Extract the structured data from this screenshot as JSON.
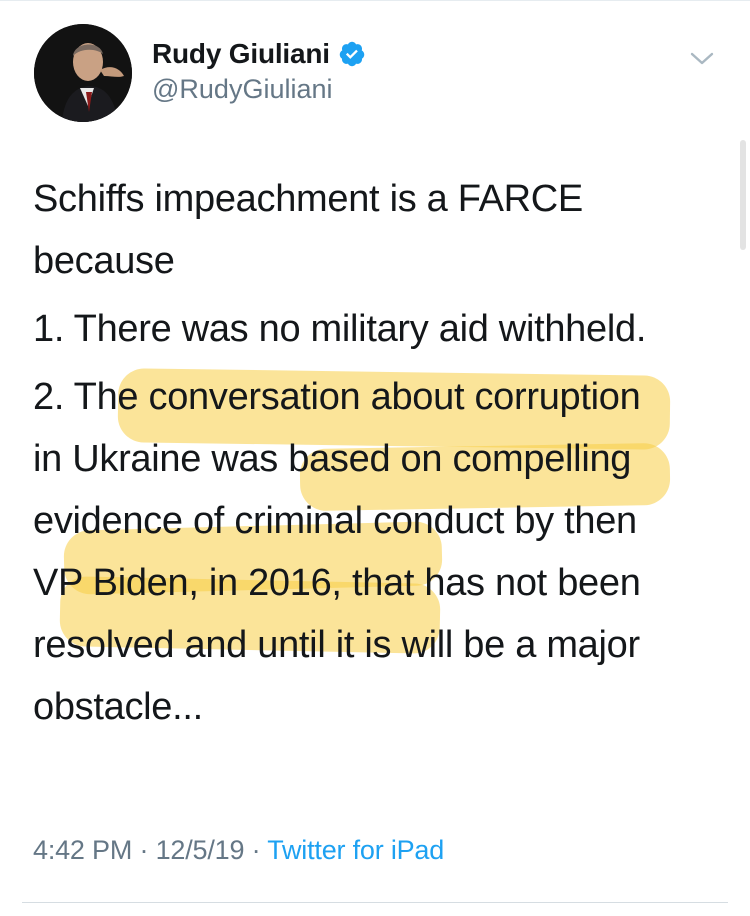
{
  "tweet": {
    "author": {
      "display_name": "Rudy Giuliani",
      "handle": "@RudyGiuliani",
      "verified": true,
      "avatar_icon": "profile-photo-icon"
    },
    "menu_icon": "chevron-down-icon",
    "text": {
      "line_1": "Schiffs impeachment is a FARCE",
      "line_2": "because",
      "line_3": "1. There was no military aid withheld.",
      "line_4": "2. The conversation about corruption",
      "line_5": "in Ukraine was based on compelling",
      "line_6": "evidence of criminal conduct by then",
      "line_7": "VP Biden, in 2016, that has not been",
      "line_8": "resolved and until it is will be a major",
      "line_9": "obstacle..."
    },
    "meta": {
      "time": "4:42 PM",
      "separator": "·",
      "date": "12/5/19",
      "source": "Twitter for iPad"
    }
  },
  "colors": {
    "text": "#14171a",
    "secondary": "#657786",
    "link": "#1da1f2",
    "verified": "#1da1f2",
    "highlighter": "#f7cd46"
  }
}
